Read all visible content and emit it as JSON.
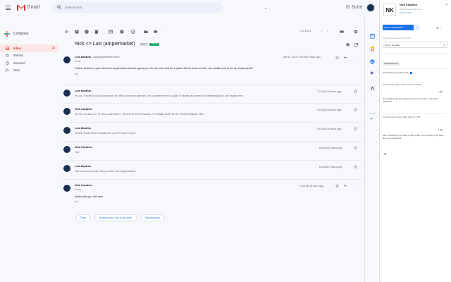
{
  "app": {
    "logo_text": "Gmail",
    "suite_label": "G Suite"
  },
  "search": {
    "placeholder": "Search mail"
  },
  "compose": {
    "label": "Compose"
  },
  "nav": [
    {
      "label": "Inbox",
      "count": "21",
      "icon": "inbox-icon",
      "active": true
    },
    {
      "label": "Starred",
      "count": "",
      "icon": "star-icon"
    },
    {
      "label": "Snoozed",
      "count": "",
      "icon": "clock-icon"
    },
    {
      "label": "Sent",
      "count": "",
      "icon": "send-icon"
    }
  ],
  "toolbar": {
    "pagination": "1 of 1,041"
  },
  "thread": {
    "subject": "Nick <> Luis (ampiemarket)",
    "labels": [
      "Inbox ×",
      "Inbound"
    ],
    "messages": [
      {
        "sender": "Luis Barahla",
        "email": "<luis@ampiemarket.com>",
        "to": "to me",
        "date": "Mar 12, 2019, 4:53 AM (5 days ago)",
        "body": "hi Nick, thanks for your interest in ampiemarket and for signing up. Do you have time for a quick call this week so that I can explain how to set up ampiemarket?",
        "expanded": true
      },
      {
        "sender": "Luis Barahla",
        "snippet": "Hi Luis, Thanks! If you took a minute, I'd take a look at my calendar. Did you have time for a quick 10 minute call tomorrow or Wednesday so I can explain more",
        "date": "7:31 AM (10 hours ago)"
      },
      {
        "sender": "Nick Kasahko",
        "snippet": "Hi Luis, no plan! I do. I'd love to work with it. I am free at 4:00 Tomorrow, or Thursday works for me. Kindest Regards, Nick",
        "date": "8:03 AM (10 hours ago)"
      },
      {
        "sender": "Luis Barahla",
        "snippet": "Hi Nick, Great! Does Thursday at 4 pm EST work for you?",
        "date": "8:13 AM (10 hours ago)"
      },
      {
        "sender": "Nick Kasahko",
        "snippet": "Yes!",
        "date": "8:40 AM (9 hours ago)"
      },
      {
        "sender": "Luis Barahla",
        "snippet": "Just sent you an invite. See you then, Luis (ampiemarket)",
        "date": "8:44 AM (9 hours ago)"
      },
      {
        "sender": "Nick Kasahko",
        "to": "to me",
        "body": "Works with you, talk later.",
        "date": "10:23 AM (8 hours ago)",
        "expanded": true
      }
    ]
  },
  "smart_replies": [
    "Great.",
    "Sounds good, talk to you then.",
    "Sounds good."
  ],
  "panel": {
    "initials": "NK",
    "name": "Nick Kasahko",
    "sub1": "nick@ampiemarket.com",
    "sub2": "View contact",
    "sequence_button": "ADD TO SEQUENCE",
    "sequence_count": "1",
    "template_label": "Personal templates for emails",
    "template_select": "Empty Template",
    "tag": "ampiemarket sub",
    "checkbox_label": "Send follow-up as automatic",
    "tasks": [
      {
        "meta": "Nick Monday, May 13th 10:18 at 4:37 PM",
        "body": "Note talking with you today? My personnel here is the data explained."
      },
      {
        "meta": "3  Ask for me to reply: May 13th 4:37 PM",
        "body": "Also: Checking if you saw my last email. Let me know if you have any more questions!"
      }
    ]
  }
}
